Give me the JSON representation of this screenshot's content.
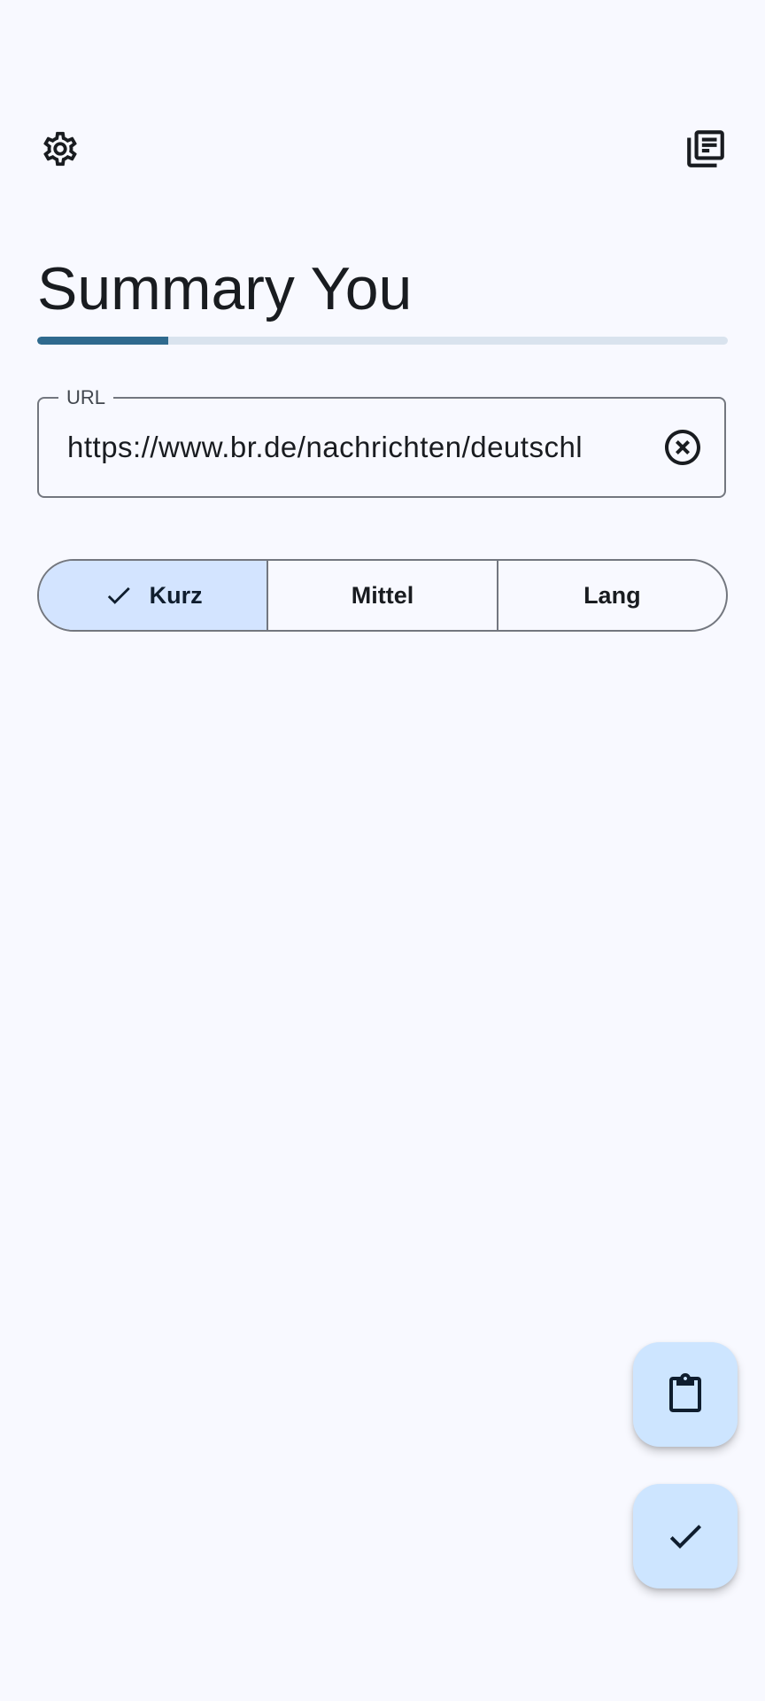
{
  "app": {
    "title": "Summary You",
    "progress": 0.19
  },
  "top_bar": {
    "settings_icon": "gear-icon",
    "library_icon": "library-books-icon"
  },
  "url_field": {
    "label": "URL",
    "value": "https://www.br.de/nachrichten/deutschl",
    "clear_icon": "cancel-circle-icon"
  },
  "length_selector": {
    "options": [
      {
        "label": "Kurz",
        "selected": true
      },
      {
        "label": "Mittel",
        "selected": false
      },
      {
        "label": "Lang",
        "selected": false
      }
    ]
  },
  "fabs": {
    "paste_icon": "clipboard-icon",
    "submit_icon": "check-icon"
  },
  "colors": {
    "background": "#f8f9ff",
    "primary": "#2f6a8e",
    "selected_segment": "#d3e4ff",
    "fab": "#cde5ff"
  }
}
